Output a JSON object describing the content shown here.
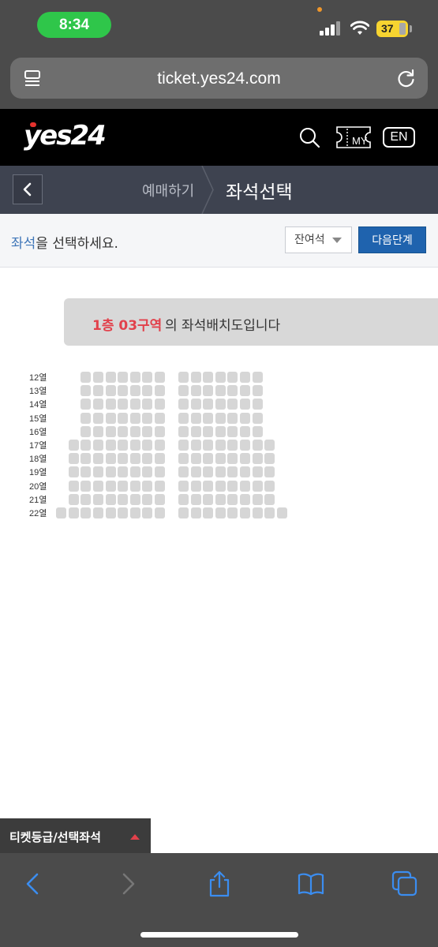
{
  "status_bar": {
    "time": "8:34",
    "battery": "37"
  },
  "browser": {
    "url": "ticket.yes24.com",
    "icons": [
      "reader-icon",
      "reload-icon",
      "back-icon",
      "forward-icon",
      "share-icon",
      "bookmarks-icon",
      "tabs-icon"
    ]
  },
  "header": {
    "logo": "yes24",
    "my_label": "MY",
    "lang_button": "EN"
  },
  "step_nav": {
    "previous_step": "예매하기",
    "current_step": "좌석선택"
  },
  "toolbar": {
    "instruction_highlight": "좌석",
    "instruction_rest": "을 선택하세요.",
    "remaining_seats_label": "잔여석",
    "next_button": "다음단계"
  },
  "section_banner": {
    "section_name": "1층 03구역",
    "suffix": "의 좌석배치도입니다"
  },
  "seat_map": {
    "rows": [
      {
        "label": "12열",
        "left_block_seats": 7,
        "right_block_seats": 7
      },
      {
        "label": "13열",
        "left_block_seats": 7,
        "right_block_seats": 7
      },
      {
        "label": "14열",
        "left_block_seats": 7,
        "right_block_seats": 7
      },
      {
        "label": "15열",
        "left_block_seats": 7,
        "right_block_seats": 7
      },
      {
        "label": "16열",
        "left_block_seats": 7,
        "right_block_seats": 7
      },
      {
        "label": "17열",
        "left_block_seats": 8,
        "right_block_seats": 8
      },
      {
        "label": "18열",
        "left_block_seats": 8,
        "right_block_seats": 8
      },
      {
        "label": "19열",
        "left_block_seats": 8,
        "right_block_seats": 8
      },
      {
        "label": "20열",
        "left_block_seats": 8,
        "right_block_seats": 8
      },
      {
        "label": "21열",
        "left_block_seats": 8,
        "right_block_seats": 8
      },
      {
        "label": "22열",
        "left_block_seats": 9,
        "right_block_seats": 9
      }
    ],
    "seat_color": "#d6d6d6"
  },
  "bottom_tab": {
    "label": "티켓등급/선택좌석"
  },
  "colors": {
    "accent_blue": "#1f63ae",
    "highlight_red": "#e2414b",
    "status_green": "#2fc64a",
    "battery_yellow": "#f7d430"
  }
}
